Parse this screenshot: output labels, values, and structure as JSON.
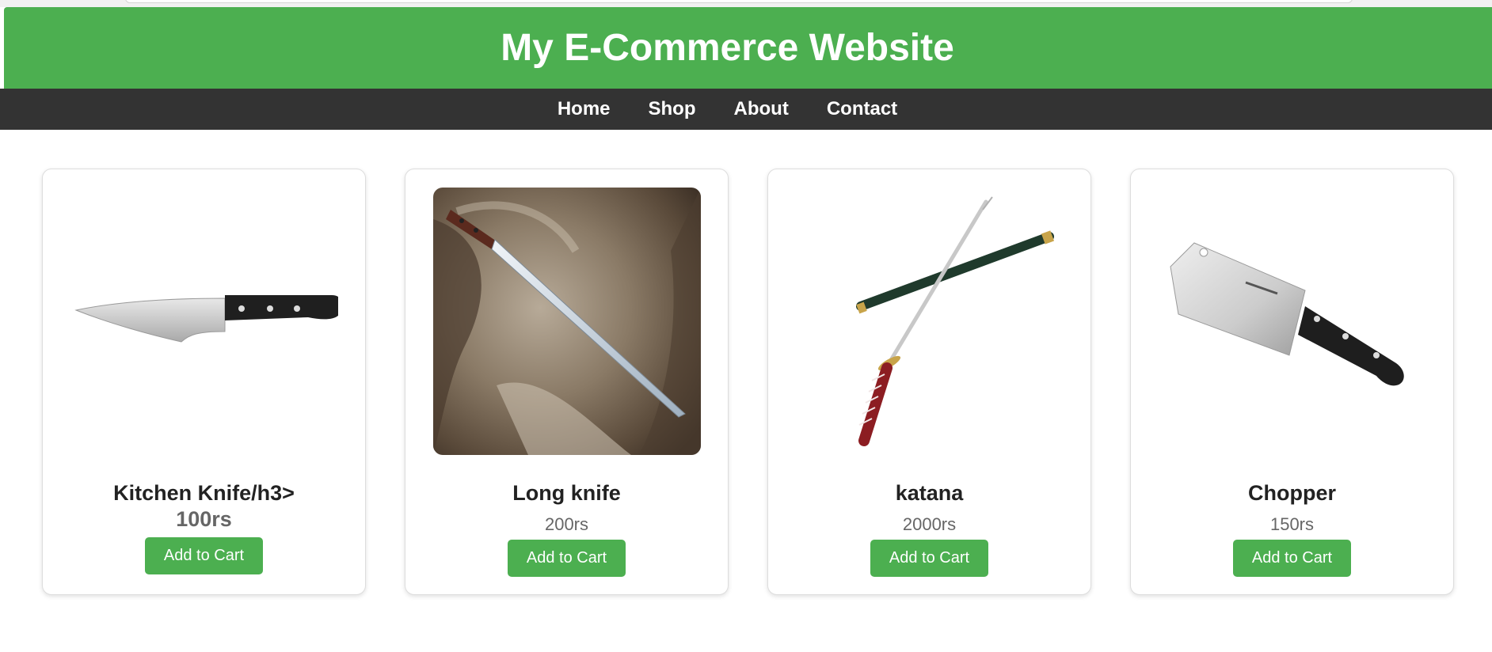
{
  "header": {
    "title": "My E-Commerce Website",
    "bg_color": "#4caf50"
  },
  "nav": {
    "bg_color": "#333333",
    "items": [
      {
        "label": "Home"
      },
      {
        "label": "Shop"
      },
      {
        "label": "About"
      },
      {
        "label": "Contact"
      }
    ]
  },
  "products": [
    {
      "name": "Kitchen Knife/h3>",
      "price": "100rs",
      "button": "Add to Cart",
      "image": "kitchen-knife-image"
    },
    {
      "name": "Long knife",
      "price": "200rs",
      "button": "Add to Cart",
      "image": "long-knife-on-fur-image"
    },
    {
      "name": "katana",
      "price": "2000rs",
      "button": "Add to Cart",
      "image": "katana-image"
    },
    {
      "name": "Chopper",
      "price": "150rs",
      "button": "Add to Cart",
      "image": "cleaver-image"
    }
  ],
  "button_color": "#4caf50"
}
